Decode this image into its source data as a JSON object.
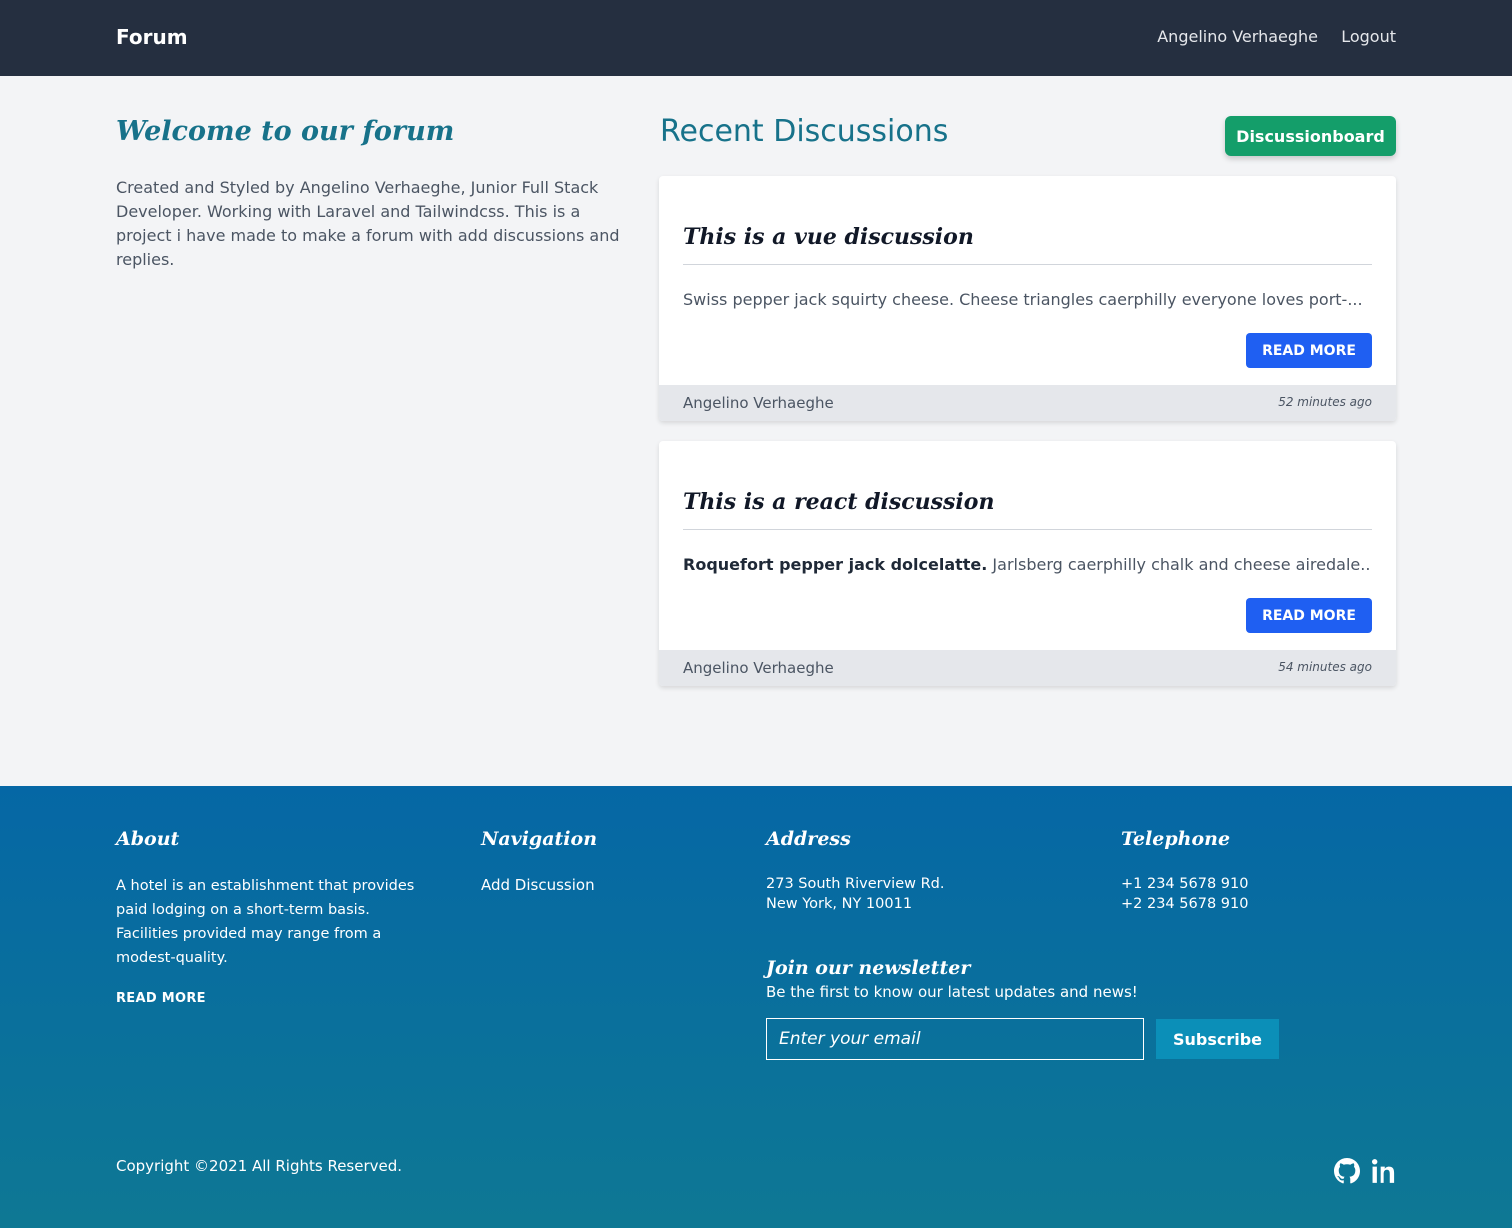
{
  "header": {
    "brand": "Forum",
    "user_name": "Angelino Verhaeghe",
    "logout": "Logout"
  },
  "intro": {
    "title": "Welcome to our forum",
    "text": "Created and Styled by Angelino Verhaeghe, Junior Full Stack Developer. Working with Laravel and Tailwindcss. This is a project i have made to make a forum with add discussions and replies."
  },
  "discussions": {
    "heading": "Recent Discussions",
    "board_button": "Discussionboard",
    "items": [
      {
        "title": "This is a vue discussion",
        "excerpt_bold": "",
        "excerpt": "Swiss pepper jack squirty cheese. Cheese triangles caerphilly everyone loves port-...",
        "read_more": "READ MORE",
        "author": "Angelino Verhaeghe",
        "time": "52 minutes ago"
      },
      {
        "title": "This is a react discussion",
        "excerpt_bold": "Roquefort pepper jack dolcelatte.",
        "excerpt": " Jarlsberg caerphilly chalk and cheese airedale...",
        "read_more": "READ MORE",
        "author": "Angelino Verhaeghe",
        "time": "54 minutes ago"
      }
    ]
  },
  "footer": {
    "about": {
      "heading": "About",
      "text": "A hotel is an establishment that provides paid lodging on a short-term basis. Facilities provided may range from a modest-quality.",
      "read_more": "READ MORE"
    },
    "navigation": {
      "heading": "Navigation",
      "link": "Add Discussion"
    },
    "address": {
      "heading": "Address",
      "line1": "273 South Riverview Rd.",
      "line2": "New York, NY 10011"
    },
    "telephone": {
      "heading": "Telephone",
      "line1": "+1 234 5678 910",
      "line2": "+2 234 5678 910"
    },
    "newsletter": {
      "heading": "Join our newsletter",
      "subtext": "Be the first to know our latest updates and news!",
      "email_placeholder": "Enter your email",
      "email_value": "",
      "subscribe": "Subscribe"
    },
    "copyright": "Copyright ©2021 All Rights Reserved.",
    "social_icons": [
      "github-icon",
      "linkedin-icon"
    ]
  },
  "colors": {
    "header_bg": "#252f40",
    "accent_teal": "#17728a",
    "green_button": "#149e6a",
    "blue_button": "#1f5ff2",
    "footer_top": "#0567a5",
    "footer_bottom": "#0e7894",
    "subscribe_button": "#0b8fb8"
  }
}
